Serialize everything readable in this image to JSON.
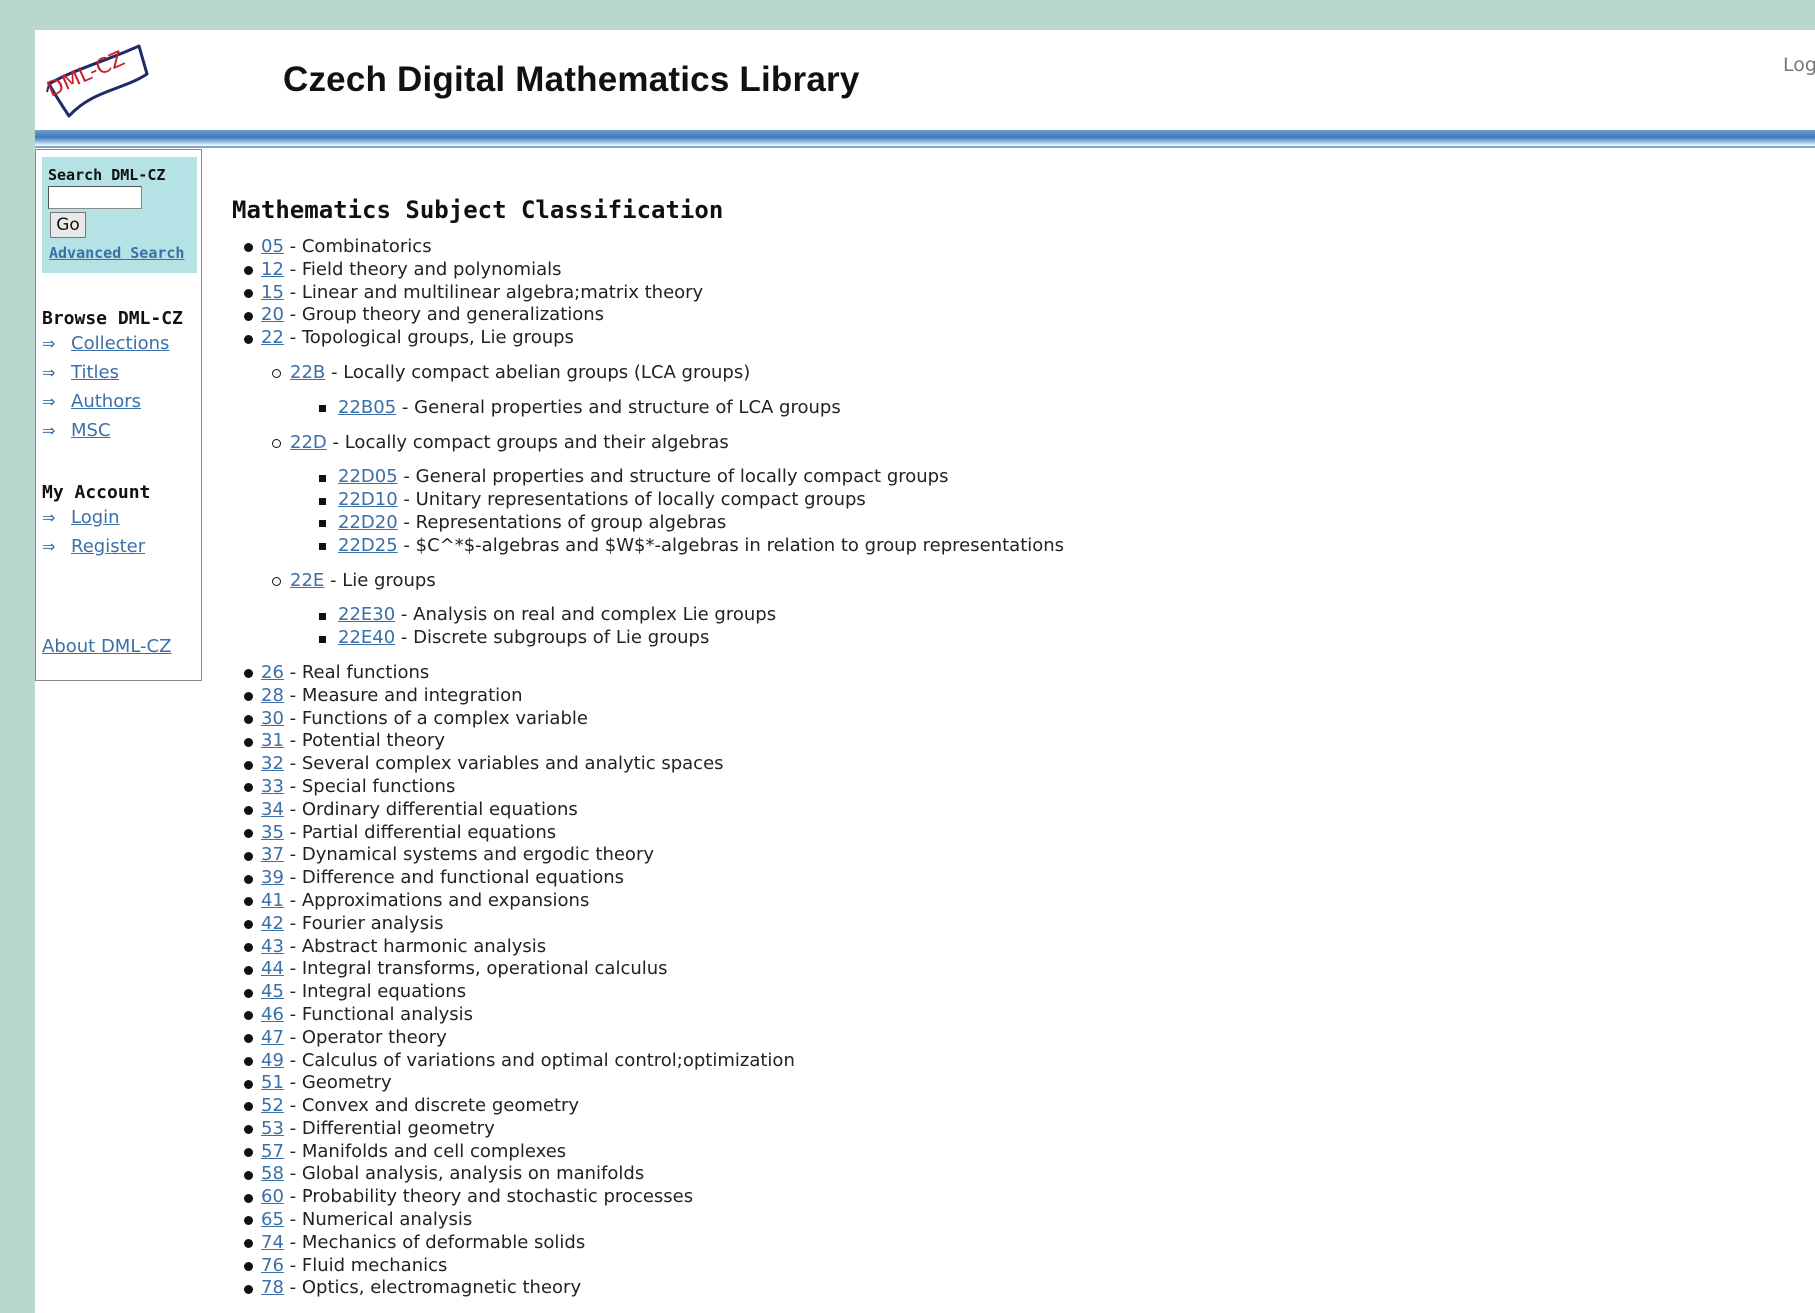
{
  "header": {
    "site_title": "Czech Digital Mathematics Library",
    "logo_text": "DML-CZ",
    "login_text": "Log"
  },
  "sidebar": {
    "search_title": "Search DML-CZ",
    "search_value": "",
    "go_label": "Go",
    "advanced_search": "Advanced Search",
    "browse_heading": "Browse DML-CZ",
    "browse_items": [
      {
        "label": "Collections"
      },
      {
        "label": "Titles"
      },
      {
        "label": "Authors"
      },
      {
        "label": "MSC"
      }
    ],
    "account_heading": "My Account",
    "account_items": [
      {
        "label": "Login"
      },
      {
        "label": "Register"
      }
    ],
    "about": "About DML-CZ",
    "arrow_glyph": "⇒"
  },
  "main": {
    "title": "Mathematics Subject Classification",
    "separator": " - ",
    "items": [
      {
        "code": "05",
        "label": "Combinatorics"
      },
      {
        "code": "12",
        "label": "Field theory and polynomials"
      },
      {
        "code": "15",
        "label": "Linear and multilinear algebra;matrix theory"
      },
      {
        "code": "20",
        "label": "Group theory and generalizations"
      },
      {
        "code": "22",
        "label": "Topological groups, Lie groups",
        "children": [
          {
            "code": "22B",
            "label": "Locally compact abelian groups (LCA groups)",
            "children": [
              {
                "code": "22B05",
                "label": "General properties and structure of LCA groups"
              }
            ]
          },
          {
            "code": "22D",
            "label": "Locally compact groups and their algebras",
            "children": [
              {
                "code": "22D05",
                "label": "General properties and structure of locally compact groups"
              },
              {
                "code": "22D10",
                "label": "Unitary representations of locally compact groups"
              },
              {
                "code": "22D20",
                "label": "Representations of group algebras"
              },
              {
                "code": "22D25",
                "label": "$C^*$-algebras and $W$*-algebras in relation to group representations"
              }
            ]
          },
          {
            "code": "22E",
            "label": "Lie groups",
            "children": [
              {
                "code": "22E30",
                "label": "Analysis on real and complex Lie groups"
              },
              {
                "code": "22E40",
                "label": "Discrete subgroups of Lie groups"
              }
            ]
          }
        ]
      },
      {
        "code": "26",
        "label": "Real functions"
      },
      {
        "code": "28",
        "label": "Measure and integration"
      },
      {
        "code": "30",
        "label": "Functions of a complex variable"
      },
      {
        "code": "31",
        "label": "Potential theory"
      },
      {
        "code": "32",
        "label": "Several complex variables and analytic spaces"
      },
      {
        "code": "33",
        "label": "Special functions"
      },
      {
        "code": "34",
        "label": "Ordinary differential equations"
      },
      {
        "code": "35",
        "label": "Partial differential equations"
      },
      {
        "code": "37",
        "label": "Dynamical systems and ergodic theory"
      },
      {
        "code": "39",
        "label": "Difference and functional equations"
      },
      {
        "code": "41",
        "label": "Approximations and expansions"
      },
      {
        "code": "42",
        "label": "Fourier analysis"
      },
      {
        "code": "43",
        "label": "Abstract harmonic analysis"
      },
      {
        "code": "44",
        "label": "Integral transforms, operational calculus"
      },
      {
        "code": "45",
        "label": "Integral equations"
      },
      {
        "code": "46",
        "label": "Functional analysis"
      },
      {
        "code": "47",
        "label": "Operator theory"
      },
      {
        "code": "49",
        "label": "Calculus of variations and optimal control;optimization"
      },
      {
        "code": "51",
        "label": "Geometry"
      },
      {
        "code": "52",
        "label": "Convex and discrete geometry"
      },
      {
        "code": "53",
        "label": "Differential geometry"
      },
      {
        "code": "57",
        "label": "Manifolds and cell complexes"
      },
      {
        "code": "58",
        "label": "Global analysis, analysis on manifolds"
      },
      {
        "code": "60",
        "label": "Probability theory and stochastic processes"
      },
      {
        "code": "65",
        "label": "Numerical analysis"
      },
      {
        "code": "74",
        "label": "Mechanics of deformable solids"
      },
      {
        "code": "76",
        "label": "Fluid mechanics"
      },
      {
        "code": "78",
        "label": "Optics, electromagnetic theory"
      }
    ]
  },
  "colors": {
    "page_background": "#b9d6cf",
    "link": "#3b6fa8",
    "search_box": "#b4e2e5",
    "header_bar": "#3f79bd",
    "logo_red": "#c8202a",
    "logo_navy": "#1f2a6b"
  }
}
